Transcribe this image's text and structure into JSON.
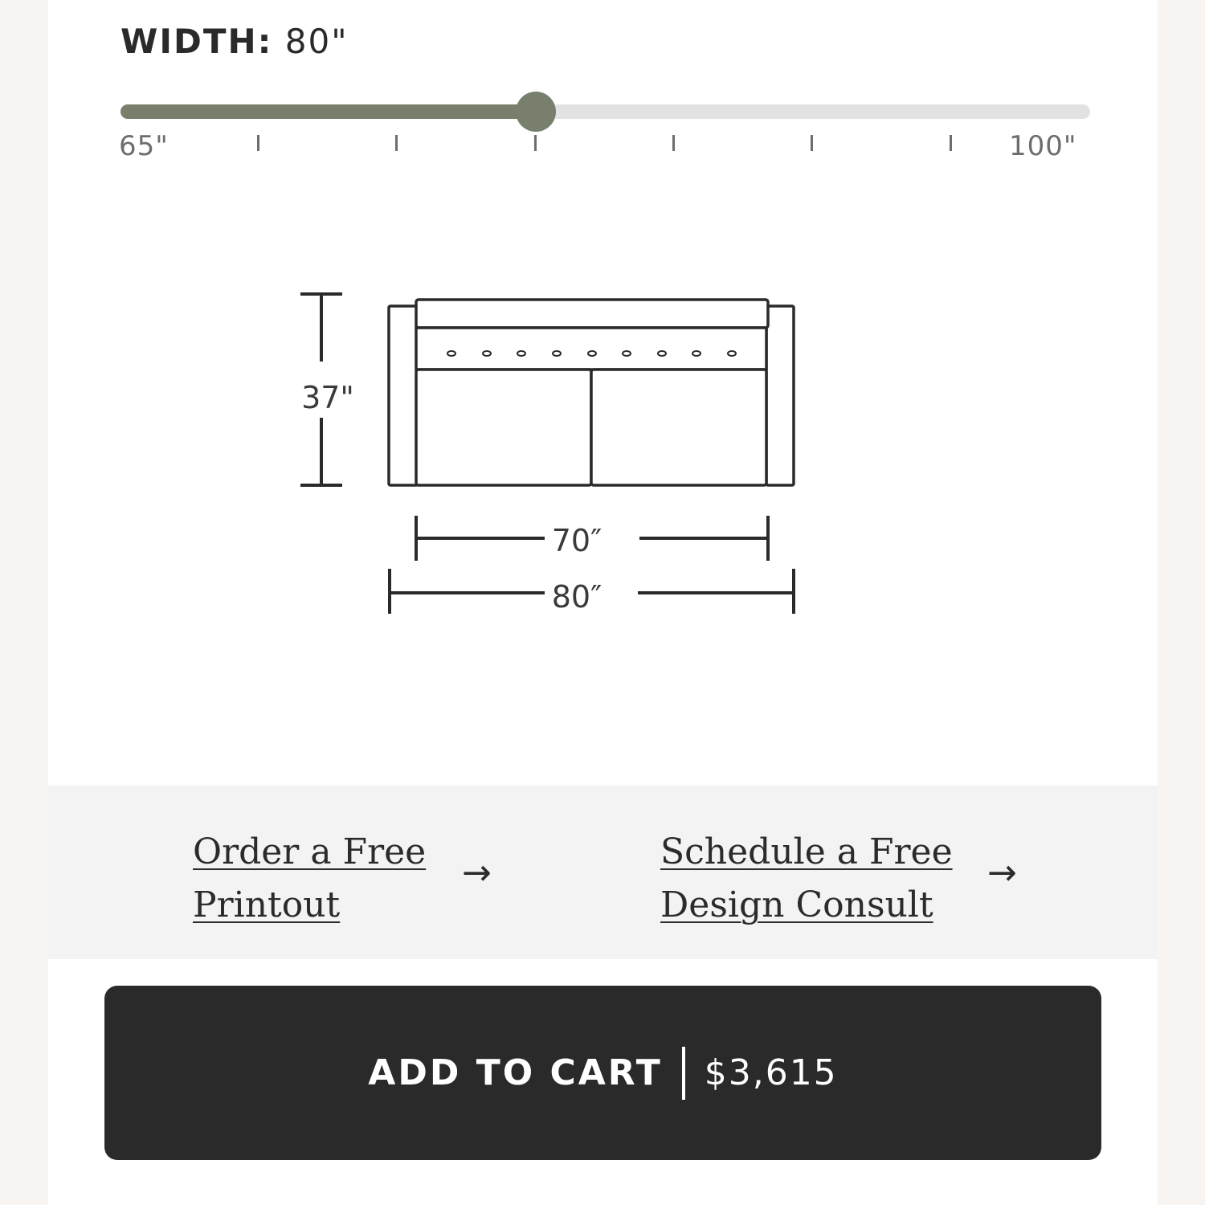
{
  "width_selector": {
    "label": "WIDTH:",
    "value": "80\"",
    "min_label": "65\"",
    "max_label": "100\"",
    "min": 65,
    "max": 100,
    "current": 80,
    "tick_count": 6,
    "fill_color": "#787f6c",
    "thumb_color": "#787f6c",
    "track_color": "#e2e2e2"
  },
  "dimensions_diagram": {
    "height_label": "37\"",
    "inner_width_label": "70″",
    "outer_width_label": "80″",
    "button_count": 9,
    "line_color": "#2a2a2a"
  },
  "links": {
    "printout": {
      "line1": "Order a Free",
      "line2": "Printout",
      "arrow": "→"
    },
    "consult": {
      "line1": "Schedule a Free",
      "line2": "Design Consult",
      "arrow": "→"
    }
  },
  "cart": {
    "label": "ADD TO CART",
    "price": "$3,615",
    "button_color": "#2a2a2a"
  }
}
